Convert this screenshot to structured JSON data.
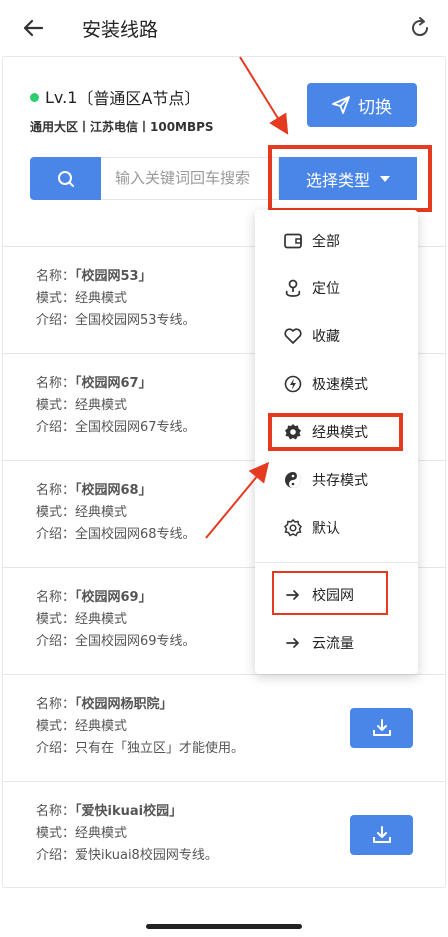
{
  "header": {
    "title": "安装线路",
    "back_icon": "arrow-left-icon",
    "refresh_icon": "refresh-icon"
  },
  "node": {
    "level": "Lv.1",
    "name": "〔普通区A节点〕",
    "status_color": "#2ecc71",
    "info": "通用大区丨江苏电信丨100MBPS"
  },
  "switch_button": {
    "label": "切换",
    "icon": "send-icon"
  },
  "search": {
    "placeholder": "输入关键词回车搜索",
    "icon": "search-icon"
  },
  "type_select": {
    "label": "选择类型"
  },
  "items": [
    {
      "name_label": "名称：",
      "name": "「校园网53」",
      "mode": "模式：经典模式",
      "intro": "介绍：全国校园网53专线。"
    },
    {
      "name_label": "名称：",
      "name": "「校园网67」",
      "mode": "模式：经典模式",
      "intro": "介绍：全国校园网67专线。"
    },
    {
      "name_label": "名称：",
      "name": "「校园网68」",
      "mode": "模式：经典模式",
      "intro": "介绍：全国校园网68专线。"
    },
    {
      "name_label": "名称：",
      "name": "「校园网69」",
      "mode": "模式：经典模式",
      "intro": "介绍：全国校园网69专线。"
    },
    {
      "name_label": "名称：",
      "name": "「校园网杨职院」",
      "mode": "模式：经典模式",
      "intro": "介绍：只有在「独立区」才能使用。"
    },
    {
      "name_label": "名称：",
      "name": "「爱快ikuai校园」",
      "mode": "模式：经典模式",
      "intro": "介绍：爱快ikuai8校园网专线。"
    }
  ],
  "dropdown": {
    "items": [
      {
        "label": "全部",
        "icon": "wallet-icon"
      },
      {
        "label": "定位",
        "icon": "location-icon"
      },
      {
        "label": "收藏",
        "icon": "heart-icon"
      },
      {
        "label": "极速模式",
        "icon": "bolt-icon"
      },
      {
        "label": "经典模式",
        "icon": "gear-icon"
      },
      {
        "label": "共存模式",
        "icon": "yin-yang-icon"
      },
      {
        "label": "默认",
        "icon": "settings-icon"
      },
      {
        "label": "校园网",
        "icon": "arrow-right-icon"
      },
      {
        "label": "云流量",
        "icon": "arrow-right-icon"
      }
    ]
  },
  "colors": {
    "accent": "#4a86e8",
    "highlight": "#e53a1f"
  }
}
